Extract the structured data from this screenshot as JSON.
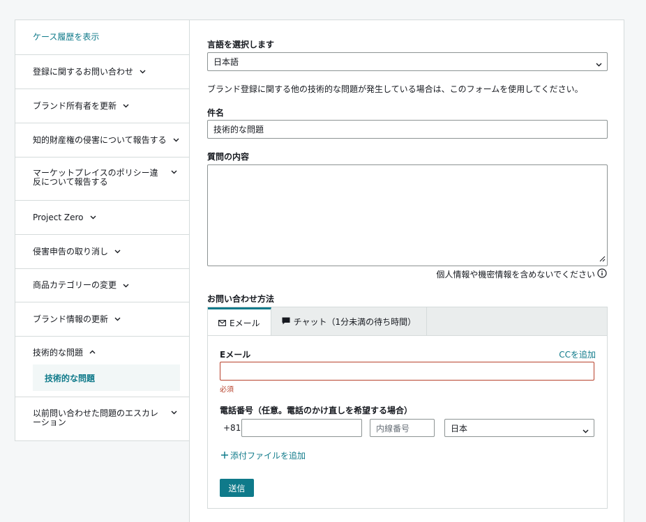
{
  "sidebar": {
    "items": [
      {
        "label": "ケース履歴を表示",
        "is_link": true
      },
      {
        "label": "登録に関するお問い合わせ"
      },
      {
        "label": "ブランド所有者を更新"
      },
      {
        "label": "知的財産権の侵害について報告する"
      },
      {
        "label": "マーケットプレイスのポリシー違反について報告する"
      },
      {
        "label": "Project Zero"
      },
      {
        "label": "侵害申告の取り消し"
      },
      {
        "label": "商品カテゴリーの変更"
      },
      {
        "label": "ブランド情報の更新"
      },
      {
        "label": "技術的な問題",
        "expanded": true
      },
      {
        "label": "以前問い合わせた問題のエスカレーション"
      }
    ],
    "sub_item": "技術的な問題"
  },
  "form": {
    "language_label": "言語を選択します",
    "language_value": "日本語",
    "description": "ブランド登録に関する他の技術的な問題が発生している場合は、このフォームを使用してください。",
    "subject_label": "件名",
    "subject_value": "技術的な問題",
    "question_label": "質問の内容",
    "privacy_note": "個人情報や機密情報を含めないでください",
    "contact_label": "お問い合わせ方法",
    "tabs": [
      {
        "label": "Eメール",
        "icon": "mail-icon",
        "active": true
      },
      {
        "label": "チャット（1分未満の待ち時間）",
        "icon": "chat-icon"
      }
    ],
    "email_label": "Eメール",
    "cc_link": "CCを追加",
    "required": "必須",
    "phone_label": "電話番号（任意。電話のかけ直しを希望する場合）",
    "country_code": "+81",
    "extension_placeholder": "内線番号",
    "country_value": "日本",
    "attach_label": "添付ファイルを追加",
    "send_label": "送信"
  },
  "colors": {
    "accent": "#0f7a8a",
    "error": "#b7412b",
    "border": "#d5dbdb"
  }
}
